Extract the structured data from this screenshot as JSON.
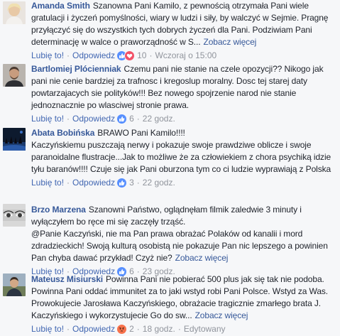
{
  "meta_labels": {
    "like": "Lubię to!",
    "reply": "Odpowiedz",
    "see_more": "Zobacz więcej",
    "dot": "·"
  },
  "comments": [
    {
      "author": "Amanda Smith",
      "text": "Szanowna Pani Kamilo, z pewnością otrzymała Pani wiele gratulacji i życzeń pomyślności, wiary w ludzi i siły, by walczyć w Sejmie. Pragnę przyłączyć się do wszystkich tych dobrych życzeń dla Pani. Podziwiam Pani determinację w walce o praworządność w S...",
      "reactions": [
        "like",
        "love"
      ],
      "count": "10",
      "time": "Wczoraj o 15:00"
    },
    {
      "author": "Bartlomiej Plócienniak",
      "text": "Czemu pani nie stanie na czele opozycji?? Nikogo jak pani nie cenie bardziej za trafnosc i kregoslup moralny. Dosc tej starej daty powtarzajacych sie polityków!!! Bez nowego spojrzenie narod nie stanie jednoznacznie po wlasciwej stronie prawa.",
      "reactions": [
        "like"
      ],
      "count": "6",
      "time": "22 godz."
    },
    {
      "author": "Abata Bobińska",
      "text": "BRAWO Pani Kamilo!!!!",
      "text2": "Kaczyńskiemu puszczają nerwy i pokazuje swoje prawdziwe oblicze i swoje paranoidalne flustracje...Jak to możliwe że za człowiekiem z chora psychiką idzie tyłu baranów!!!! Czuje się jak Pani oburzona tym co ci ludzie wyprawiają z Polska",
      "reactions": [
        "like"
      ],
      "count": "3",
      "time": "22 godz."
    },
    {
      "author": "Brzo Marzena",
      "text": "Szanowni Państwo, oglądnęłam filmik zaledwie 3 minuty i wyłączyłem bo ręce mi się zaczęły trząść.",
      "text2": "@Panie Kaczyński, nie ma Pan prawa obrażać Polaków od kanalii i mord zdradzieckich! Swoją kulturą osobistą nie pokazuje Pan nic lepszego a powinien Pan chyba dawać przykład! Czyż nie?",
      "reactions": [
        "like"
      ],
      "count": "6",
      "time": "23 godz."
    },
    {
      "author": "Mateusz Misiurski",
      "text": "Powinna Pani nie pobierać 500 plus jak się tak nie podoba. Powinna Pani oddać immunitet za to jaki wstyd robi Pani Polsce. Wstyd za Was. Prowokujecie Jarosława Kaczyńskiego, obrażacie tragicznie zmarłego brata J. Kaczyńskiego i wykorzystujecie Go do sw...",
      "reactions": [
        "angry"
      ],
      "count": "2",
      "time": "18 godz.",
      "edited": "Edytowany"
    }
  ],
  "colors": {
    "link": "#365899",
    "action": "#4267b2",
    "muted": "#90949c",
    "like": "#5890ff",
    "love": "#f25268",
    "angry": "#f7714b"
  }
}
